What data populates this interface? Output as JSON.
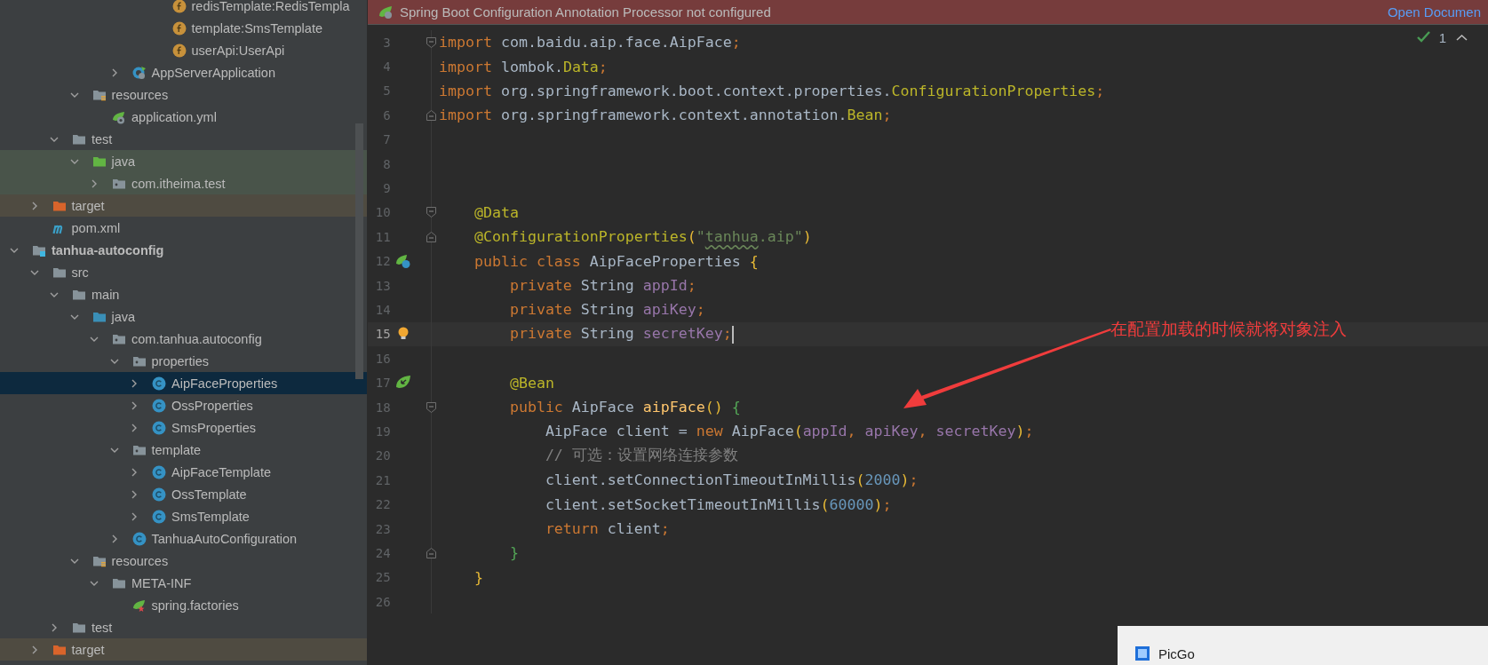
{
  "project_tree": [
    {
      "children": [
        {
          "children": [
            {
              "children": [
                {
                  "children": [
                    {
                      "children": [
                        {
                          "children": [
                            {
                              "children": [
                                {
                                  "label": "redisTemplate:RedisTempla",
                                  "kind": "field",
                                  "selected": false
                                },
                                {
                                  "label": "template:SmsTemplate",
                                  "kind": "field",
                                  "selected": false
                                },
                                {
                                  "label": "userApi:UserApi",
                                  "kind": "field",
                                  "selected": false
                                }
                              ]
                            }
                          ]
                        },
                        {
                          "label": "AppServerApplication",
                          "kind": "spring-app",
                          "expanded": false,
                          "selected": false
                        }
                      ]
                    }
                  ]
                },
                {
                  "label": "resources",
                  "kind": "resources-folder",
                  "expanded": true,
                  "selected": false,
                  "children": [
                    {
                      "label": "application.yml",
                      "kind": "spring-config",
                      "selected": false
                    }
                  ]
                }
              ]
            },
            {
              "label": "test",
              "kind": "folder",
              "expanded": true,
              "selected": false,
              "children": [
                {
                  "label": "java",
                  "kind": "test-source-folder",
                  "expanded": true,
                  "selected": false,
                  "children": [
                    {
                      "label": "com.itheima.test",
                      "kind": "test-package",
                      "expanded": false,
                      "selected": false
                    }
                  ]
                }
              ]
            }
          ]
        },
        {
          "label": "target",
          "kind": "excluded-folder",
          "expanded": false,
          "selected": false
        },
        {
          "label": "pom.xml",
          "kind": "maven",
          "selected": false
        }
      ]
    },
    {
      "label": "tanhua-autoconfig",
      "kind": "module",
      "expanded": true,
      "selected": false,
      "children": [
        {
          "label": "src",
          "kind": "folder",
          "expanded": true,
          "selected": false,
          "children": [
            {
              "label": "main",
              "kind": "folder",
              "expanded": true,
              "selected": false,
              "children": [
                {
                  "label": "java",
                  "kind": "source-folder",
                  "expanded": true,
                  "selected": false,
                  "children": [
                    {
                      "label": "com.tanhua.autoconfig",
                      "kind": "package",
                      "expanded": true,
                      "selected": false,
                      "children": [
                        {
                          "label": "properties",
                          "kind": "package",
                          "expanded": true,
                          "selected": false,
                          "children": [
                            {
                              "label": "AipFaceProperties",
                              "kind": "class",
                              "expanded": false,
                              "selected": true
                            },
                            {
                              "label": "OssProperties",
                              "kind": "class",
                              "expanded": false,
                              "selected": false
                            },
                            {
                              "label": "SmsProperties",
                              "kind": "class",
                              "expanded": false,
                              "selected": false
                            }
                          ]
                        },
                        {
                          "label": "template",
                          "kind": "package",
                          "expanded": true,
                          "selected": false,
                          "children": [
                            {
                              "label": "AipFaceTemplate",
                              "kind": "class",
                              "expanded": false,
                              "selected": false
                            },
                            {
                              "label": "OssTemplate",
                              "kind": "class",
                              "expanded": false,
                              "selected": false
                            },
                            {
                              "label": "SmsTemplate",
                              "kind": "class",
                              "expanded": false,
                              "selected": false
                            }
                          ]
                        },
                        {
                          "label": "TanhuaAutoConfiguration",
                          "kind": "class",
                          "expanded": false,
                          "selected": false
                        }
                      ]
                    }
                  ]
                },
                {
                  "label": "resources",
                  "kind": "resources-folder",
                  "expanded": true,
                  "selected": false,
                  "children": [
                    {
                      "label": "META-INF",
                      "kind": "folder",
                      "expanded": true,
                      "selected": false,
                      "children": [
                        {
                          "label": "spring.factories",
                          "kind": "spring-factories",
                          "selected": false
                        }
                      ]
                    }
                  ]
                }
              ]
            },
            {
              "label": "test",
              "kind": "folder",
              "expanded": false,
              "selected": false
            }
          ]
        },
        {
          "label": "target",
          "kind": "excluded-folder",
          "expanded": false,
          "selected": false
        }
      ]
    }
  ],
  "banner": {
    "text": "Spring Boot Configuration Annotation Processor not configured",
    "link": "Open Documen"
  },
  "inspection": {
    "count": "1"
  },
  "code": [
    {
      "number": "3",
      "kind": "fold-start",
      "current": false,
      "tokens": [
        {
          "t": "import",
          "kind": "keyword"
        },
        {
          "t": " com.baidu.aip.face.AipFace",
          "kind": "plain"
        },
        {
          "t": ";",
          "kind": "keyword"
        }
      ]
    },
    {
      "number": "4",
      "kind": "plain",
      "current": false,
      "tokens": [
        {
          "t": "import",
          "kind": "keyword"
        },
        {
          "t": " lombok.",
          "kind": "plain"
        },
        {
          "t": "Data",
          "kind": "annotation"
        },
        {
          "t": ";",
          "kind": "keyword"
        }
      ]
    },
    {
      "number": "5",
      "kind": "plain",
      "current": false,
      "tokens": [
        {
          "t": "import",
          "kind": "keyword"
        },
        {
          "t": " org.springframework.boot.context.properties.",
          "kind": "plain"
        },
        {
          "t": "ConfigurationProperties",
          "kind": "annotation"
        },
        {
          "t": ";",
          "kind": "keyword"
        }
      ]
    },
    {
      "number": "6",
      "kind": "fold-end",
      "current": false,
      "tokens": [
        {
          "t": "import",
          "kind": "keyword"
        },
        {
          "t": " org.springframework.context.annotation.",
          "kind": "plain"
        },
        {
          "t": "Bean",
          "kind": "annotation"
        },
        {
          "t": ";",
          "kind": "keyword"
        }
      ]
    },
    {
      "number": "7",
      "kind": "plain",
      "current": false
    },
    {
      "number": "8",
      "kind": "plain",
      "current": false
    },
    {
      "number": "9",
      "kind": "plain",
      "current": false
    },
    {
      "number": "10",
      "kind": "fold-start",
      "current": false,
      "tokens": [
        {
          "t": "    @Data",
          "kind": "annotation"
        }
      ]
    },
    {
      "number": "11",
      "kind": "fold-end",
      "current": false,
      "tokens": [
        {
          "t": "    @ConfigurationProperties",
          "kind": "annotation"
        },
        {
          "t": "(",
          "kind": "bracket1"
        },
        {
          "t": "\"",
          "kind": "string"
        },
        {
          "t": "tanhua",
          "kind": "string-typo"
        },
        {
          "t": ".aip\"",
          "kind": "string"
        },
        {
          "t": ")",
          "kind": "bracket1"
        }
      ]
    },
    {
      "number": "12",
      "kind": "bean",
      "current": false,
      "tokens": [
        {
          "t": "    public class ",
          "kind": "keyword"
        },
        {
          "t": "AipFaceProperties ",
          "kind": "plain"
        },
        {
          "t": "{",
          "kind": "bracket1"
        }
      ]
    },
    {
      "number": "13",
      "kind": "plain",
      "current": false,
      "tokens": [
        {
          "t": "        private ",
          "kind": "keyword"
        },
        {
          "t": "String ",
          "kind": "plain"
        },
        {
          "t": "appId",
          "kind": "field"
        },
        {
          "t": ";",
          "kind": "keyword"
        }
      ]
    },
    {
      "number": "14",
      "kind": "plain",
      "current": false,
      "tokens": [
        {
          "t": "        private ",
          "kind": "keyword"
        },
        {
          "t": "String ",
          "kind": "plain"
        },
        {
          "t": "apiKey",
          "kind": "field"
        },
        {
          "t": ";",
          "kind": "keyword"
        }
      ]
    },
    {
      "number": "15",
      "kind": "bulb",
      "current": true,
      "tokens": [
        {
          "t": "        private ",
          "kind": "keyword"
        },
        {
          "t": "String ",
          "kind": "plain"
        },
        {
          "t": "secretKey",
          "kind": "field"
        },
        {
          "t": ";",
          "kind": "keyword"
        }
      ]
    },
    {
      "number": "16",
      "kind": "plain",
      "current": false
    },
    {
      "number": "17",
      "kind": "bean-navigate",
      "current": false,
      "tokens": [
        {
          "t": "        @Bean",
          "kind": "annotation"
        }
      ]
    },
    {
      "number": "18",
      "kind": "fold-start",
      "current": false,
      "tokens": [
        {
          "t": "        public ",
          "kind": "keyword"
        },
        {
          "t": "AipFace ",
          "kind": "plain"
        },
        {
          "t": "aipFace",
          "kind": "method"
        },
        {
          "t": "()",
          "kind": "bracket1"
        },
        {
          "t": " {",
          "kind": "bracket2"
        }
      ]
    },
    {
      "number": "19",
      "kind": "plain",
      "current": false,
      "tokens": [
        {
          "t": "            AipFace client = ",
          "kind": "plain"
        },
        {
          "t": "new ",
          "kind": "keyword"
        },
        {
          "t": "AipFace",
          "kind": "plain"
        },
        {
          "t": "(",
          "kind": "bracket1"
        },
        {
          "t": "appId",
          "kind": "field"
        },
        {
          "t": ", ",
          "kind": "keyword"
        },
        {
          "t": "apiKey",
          "kind": "field"
        },
        {
          "t": ", ",
          "kind": "keyword"
        },
        {
          "t": "secretKey",
          "kind": "field"
        },
        {
          "t": ")",
          "kind": "bracket1"
        },
        {
          "t": ";",
          "kind": "keyword"
        }
      ]
    },
    {
      "number": "20",
      "kind": "plain",
      "current": false,
      "tokens": [
        {
          "t": "            // 可选：设置网络连接参数",
          "kind": "comment"
        }
      ]
    },
    {
      "number": "21",
      "kind": "plain",
      "current": false,
      "tokens": [
        {
          "t": "            client.setConnectionTimeoutInMillis",
          "kind": "plain"
        },
        {
          "t": "(",
          "kind": "bracket1"
        },
        {
          "t": "2000",
          "kind": "number"
        },
        {
          "t": ")",
          "kind": "bracket1"
        },
        {
          "t": ";",
          "kind": "keyword"
        }
      ]
    },
    {
      "number": "22",
      "kind": "plain",
      "current": false,
      "tokens": [
        {
          "t": "            client.setSocketTimeoutInMillis",
          "kind": "plain"
        },
        {
          "t": "(",
          "kind": "bracket1"
        },
        {
          "t": "60000",
          "kind": "number"
        },
        {
          "t": ")",
          "kind": "bracket1"
        },
        {
          "t": ";",
          "kind": "keyword"
        }
      ]
    },
    {
      "number": "23",
      "kind": "plain",
      "current": false,
      "tokens": [
        {
          "t": "            return ",
          "kind": "keyword"
        },
        {
          "t": "client",
          "kind": "plain"
        },
        {
          "t": ";",
          "kind": "keyword"
        }
      ]
    },
    {
      "number": "24",
      "kind": "fold-end",
      "current": false,
      "tokens": [
        {
          "t": "        }",
          "kind": "bracket2"
        }
      ]
    },
    {
      "number": "25",
      "kind": "plain",
      "current": false,
      "tokens": [
        {
          "t": "    }",
          "kind": "bracket1"
        }
      ]
    },
    {
      "number": "26",
      "kind": "plain",
      "current": false
    }
  ],
  "annotation": {
    "text": "在配置加载的时候就将对象注入"
  },
  "taskbar_popup": {
    "title": "PicGo"
  }
}
